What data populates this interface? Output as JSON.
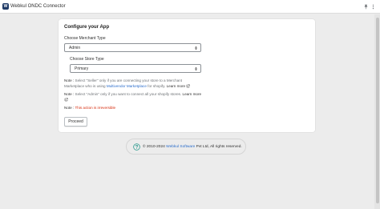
{
  "app": {
    "logo_letter": "W",
    "title": "Webkul ONDC Connector"
  },
  "colors": {
    "accent": "#2c6ecb",
    "danger": "#d72c0d",
    "logo_bg": "#1f3a66"
  },
  "icons": [
    "pin-icon",
    "more-vertical-icon",
    "chevron-updown-icon",
    "external-link-icon",
    "help-circle-icon"
  ],
  "config": {
    "title": "Configure your App",
    "merchant_label": "Choose Merchant Type",
    "merchant_value": "Admin",
    "store_label": "Choose Store Type",
    "store_value": "Primary",
    "note1": {
      "prefix": "Note :",
      "text": " Select \"Seller\" only if you are connecting your store to a Merchant Marketplace who is using ",
      "link": "Multivendor Marketplace",
      "suffix": " for shopify.",
      "learn_more": "Learn more"
    },
    "note2": {
      "prefix": "Note :",
      "text": " Select \"Admin\" only if you want to connect all your shopify stores.",
      "learn_more": "Learn more"
    },
    "note3": {
      "prefix": "Note :",
      "warning": "This action is irreversible"
    },
    "proceed_label": "Proceed"
  },
  "footer": {
    "prefix": "© 2010-2024",
    "company": "Webkul Software",
    "suffix": "Pvt Ltd, All rights reserved."
  }
}
